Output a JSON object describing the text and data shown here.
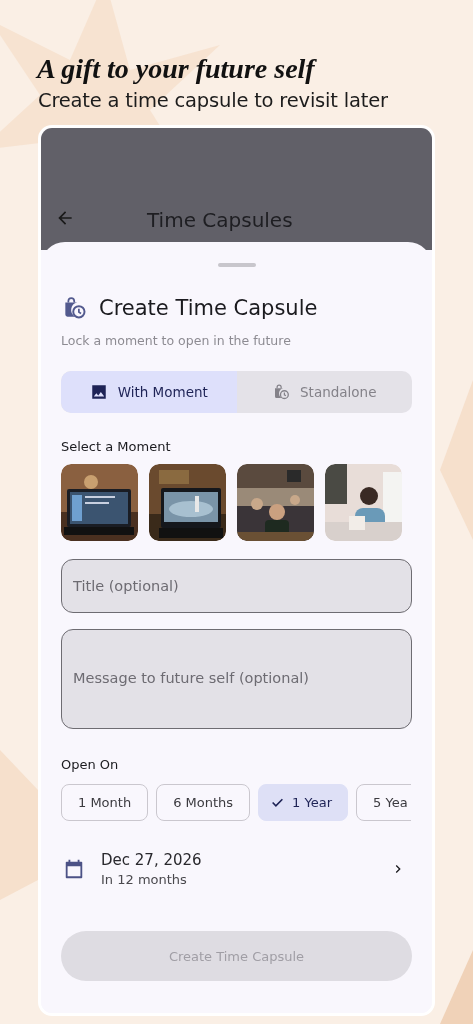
{
  "header": {
    "title": "A gift to your future self",
    "subtitle": "Create a time capsule to revisit later"
  },
  "app_bar": {
    "title": "Time Capsules"
  },
  "sheet": {
    "title": "Create Time Capsule",
    "subtitle": "Lock a moment to open in the future",
    "modes": [
      {
        "label": "With Moment",
        "kind": "moment",
        "selected": true
      },
      {
        "label": "Standalone",
        "kind": "standalone",
        "selected": false
      }
    ],
    "moments_label": "Select a Moment",
    "title_field": {
      "placeholder": "Title (optional)"
    },
    "message_field": {
      "placeholder": "Message to future self (optional)"
    },
    "open_on_label": "Open On",
    "durations": [
      {
        "label": "1 Month",
        "selected": false
      },
      {
        "label": "6 Months",
        "selected": false
      },
      {
        "label": "1 Year",
        "selected": true
      },
      {
        "label": "5 Yea",
        "selected": false
      }
    ],
    "date": {
      "value": "Dec 27, 2026",
      "relative": "In 12 months"
    },
    "submit": {
      "label": "Create Time Capsule",
      "disabled": true
    }
  }
}
